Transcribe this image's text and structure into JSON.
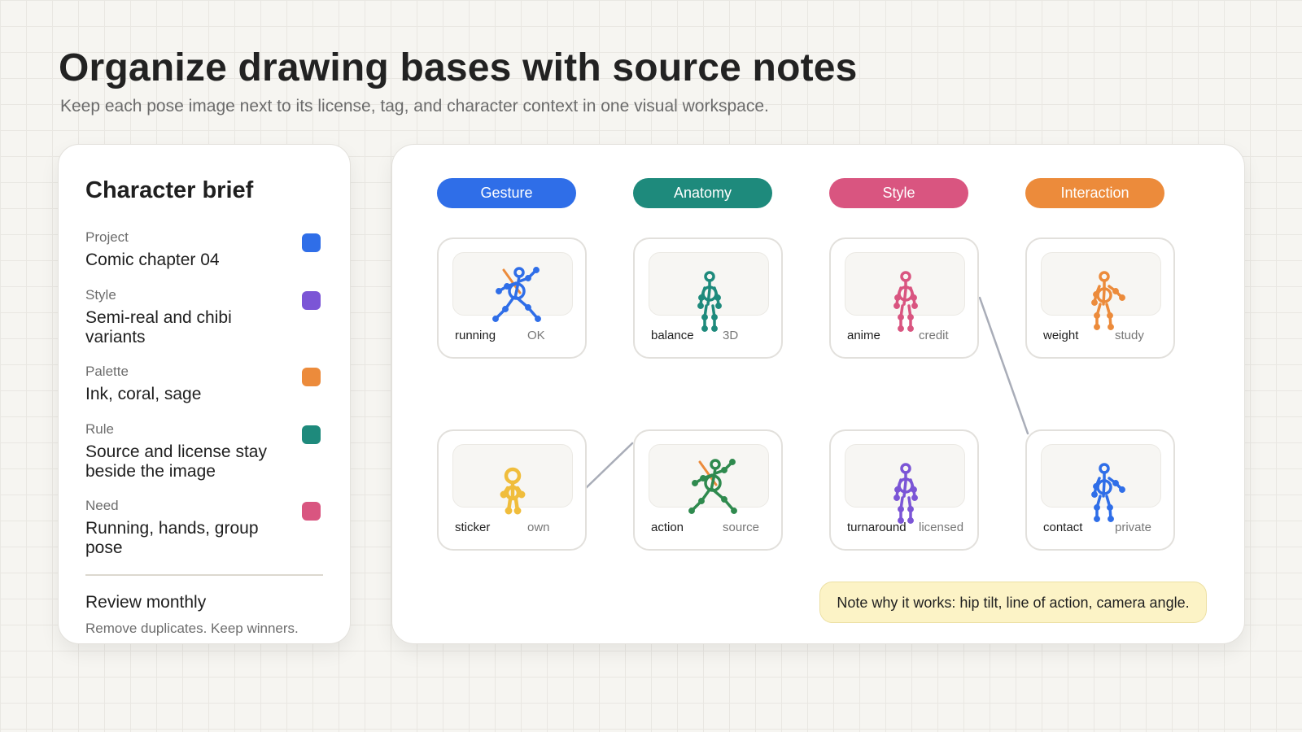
{
  "header": {
    "title": "Organize drawing bases with source notes",
    "subtitle": "Keep each pose image next to its license, tag, and character context in one visual workspace."
  },
  "brief": {
    "title": "Character brief",
    "fields": [
      {
        "label": "Project",
        "value": "Comic chapter 04",
        "color": "#2f6ee8"
      },
      {
        "label": "Style",
        "value": "Semi-real and chibi variants",
        "color": "#7b55d6"
      },
      {
        "label": "Palette",
        "value": "Ink, coral, sage",
        "color": "#ec8b3b"
      },
      {
        "label": "Rule",
        "value": "Source and license stay beside the image",
        "color": "#1e8a7c"
      },
      {
        "label": "Need",
        "value": "Running, hands, group pose",
        "color": "#d95580"
      }
    ],
    "review_title": "Review monthly",
    "review_note": "Remove duplicates. Keep winners."
  },
  "board": {
    "categories": [
      {
        "label": "Gesture",
        "color": "#2f6ee8"
      },
      {
        "label": "Anatomy",
        "color": "#1e8a7c"
      },
      {
        "label": "Style",
        "color": "#d95580"
      },
      {
        "label": "Interaction",
        "color": "#ec8b3b"
      }
    ],
    "cards": [
      {
        "tag": "running",
        "note": "OK",
        "color": "#2f6ee8",
        "accent": "#ec8b3b",
        "pose": "dynamic"
      },
      {
        "tag": "balance",
        "note": "3D",
        "color": "#1e8a7c",
        "pose": "standing"
      },
      {
        "tag": "anime",
        "note": "credit",
        "color": "#d95580",
        "pose": "standing"
      },
      {
        "tag": "weight",
        "note": "study",
        "color": "#ec8b3b",
        "pose": "reaching"
      },
      {
        "tag": "sticker",
        "note": "own",
        "color": "#f0bd3c",
        "pose": "chibi"
      },
      {
        "tag": "action",
        "note": "source",
        "color": "#2f8a4e",
        "accent": "#ec8b3b",
        "pose": "dynamic"
      },
      {
        "tag": "turnaround",
        "note": "licensed",
        "color": "#7b55d6",
        "pose": "standing"
      },
      {
        "tag": "contact",
        "note": "private",
        "color": "#2f6ee8",
        "pose": "reaching"
      }
    ],
    "note": "Note why it works: hip tilt, line of action, camera angle."
  }
}
